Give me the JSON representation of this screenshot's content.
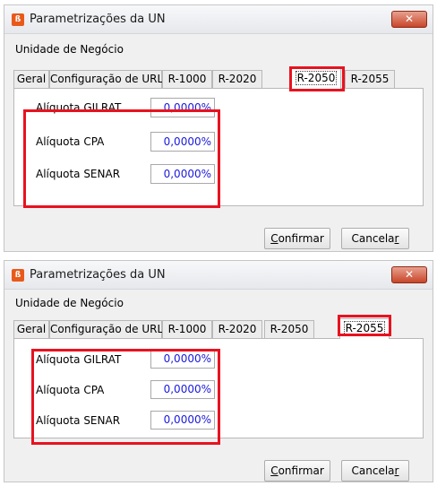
{
  "dialogs": [
    {
      "title": "Parametrizações da UN",
      "app_icon_glyph": "ß",
      "close_glyph": "✕",
      "group_label": "Unidade de Negócio",
      "tabs": [
        "Geral",
        "Configuração de URL",
        "R-1000",
        "R-2020",
        "R-2050",
        "R-2055"
      ],
      "active_tab": "R-2050",
      "fields": [
        {
          "label": "Alíquota GILRAT",
          "value": "0,0000%"
        },
        {
          "label": "Alíquota CPA",
          "value": "0,0000%"
        },
        {
          "label": "Alíquota SENAR",
          "value": "0,0000%"
        }
      ],
      "buttons": {
        "confirm": {
          "accel": "C",
          "rest": "onfirmar"
        },
        "cancel": {
          "text": "Cancela",
          "accel": "r"
        }
      }
    },
    {
      "title": "Parametrizações da UN",
      "app_icon_glyph": "ß",
      "close_glyph": "✕",
      "group_label": "Unidade de Negócio",
      "tabs": [
        "Geral",
        "Configuração de URL",
        "R-1000",
        "R-2020",
        "R-2050",
        "R-2055"
      ],
      "active_tab": "R-2055",
      "fields": [
        {
          "label": "Alíquota GILRAT",
          "value": "0,0000%"
        },
        {
          "label": "Alíquota CPA",
          "value": "0,0000%"
        },
        {
          "label": "Alíquota SENAR",
          "value": "0,0000%"
        }
      ],
      "buttons": {
        "confirm": {
          "accel": "C",
          "rest": "onfirmar"
        },
        "cancel": {
          "text": "Cancela",
          "accel": "r"
        }
      }
    }
  ],
  "colors": {
    "highlight": "#e8121f",
    "input_value": "#1a1adc",
    "close_button": "#c8462a"
  }
}
